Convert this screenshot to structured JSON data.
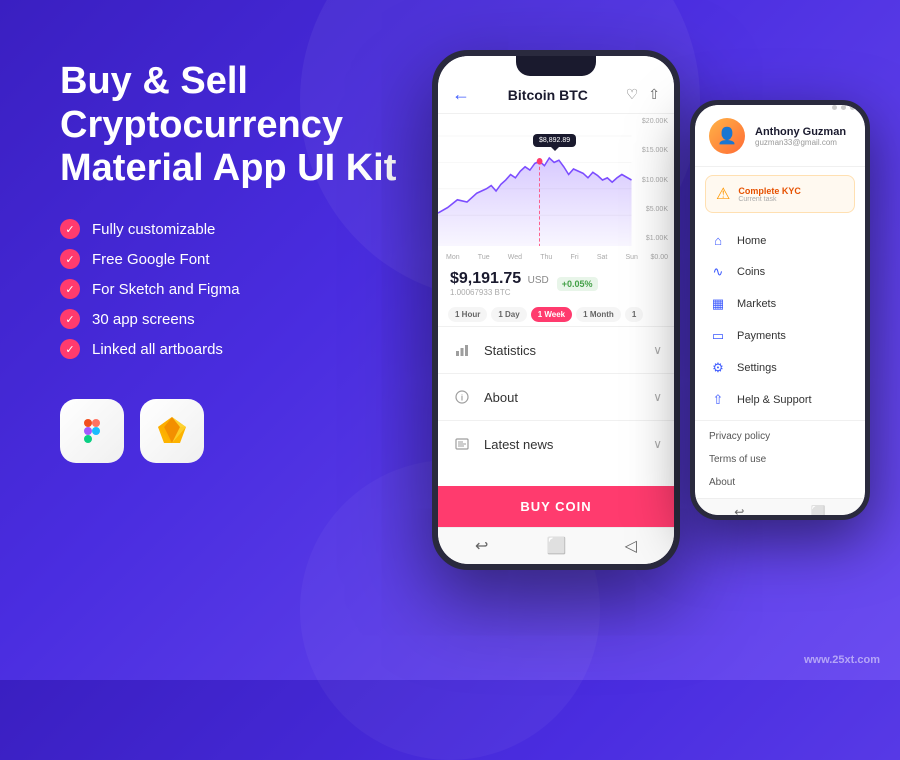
{
  "background": {
    "gradient_start": "#3a1fc1",
    "gradient_end": "#6b4cf0"
  },
  "hero": {
    "title": "Buy & Sell\nCryptocurrency\nMaterial App UI Kit"
  },
  "features": [
    "Fully customizable",
    "Free Google Font",
    "For Sketch and Figma",
    "30 app screens",
    "Linked all artboards"
  ],
  "tools": [
    {
      "name": "Figma",
      "icon": "figma-icon"
    },
    {
      "name": "Sketch",
      "icon": "sketch-icon"
    }
  ],
  "phone_main": {
    "header": {
      "back_icon": "back-arrow-icon",
      "title": "Bitcoin BTC",
      "heart_icon": "heart-icon",
      "share_icon": "share-icon"
    },
    "chart": {
      "y_labels": [
        "$20.00K",
        "$15.00K",
        "$10.00K",
        "$5.00K",
        "$1.00K"
      ],
      "x_labels": [
        "Mon",
        "Tue",
        "Wed",
        "Thu",
        "Fri",
        "Sat",
        "Sun",
        "$0.00"
      ],
      "tooltip": "$8,892.89"
    },
    "price": {
      "value": "$9,191.75",
      "currency": "USD",
      "change": "+0.05%",
      "btc": "1.00067933 BTC"
    },
    "time_filters": [
      "1 Hour",
      "1 Day",
      "1 Week",
      "1 Month",
      "1"
    ],
    "active_filter": "1 Week",
    "accordion": [
      {
        "label": "Statistics",
        "icon": "bar-chart-icon"
      },
      {
        "label": "About",
        "icon": "info-icon"
      },
      {
        "label": "Latest news",
        "icon": "news-icon"
      }
    ],
    "buy_button": "BUY COIN"
  },
  "phone_second": {
    "profile": {
      "name": "Anthony Guzman",
      "email": "guzman33@gmail.com"
    },
    "kyc": {
      "title": "Complete KYC",
      "subtitle": "Current task"
    },
    "menu_items": [
      {
        "label": "Home",
        "icon": "home-icon"
      },
      {
        "label": "Coins",
        "icon": "coins-icon"
      },
      {
        "label": "Markets",
        "icon": "markets-icon"
      },
      {
        "label": "Payments",
        "icon": "payments-icon"
      },
      {
        "label": "Settings",
        "icon": "settings-icon"
      },
      {
        "label": "Help & Support",
        "icon": "help-icon"
      }
    ],
    "text_links": [
      "Privacy policy",
      "Terms of use",
      "About"
    ]
  },
  "watermark": "www.25xt.com"
}
